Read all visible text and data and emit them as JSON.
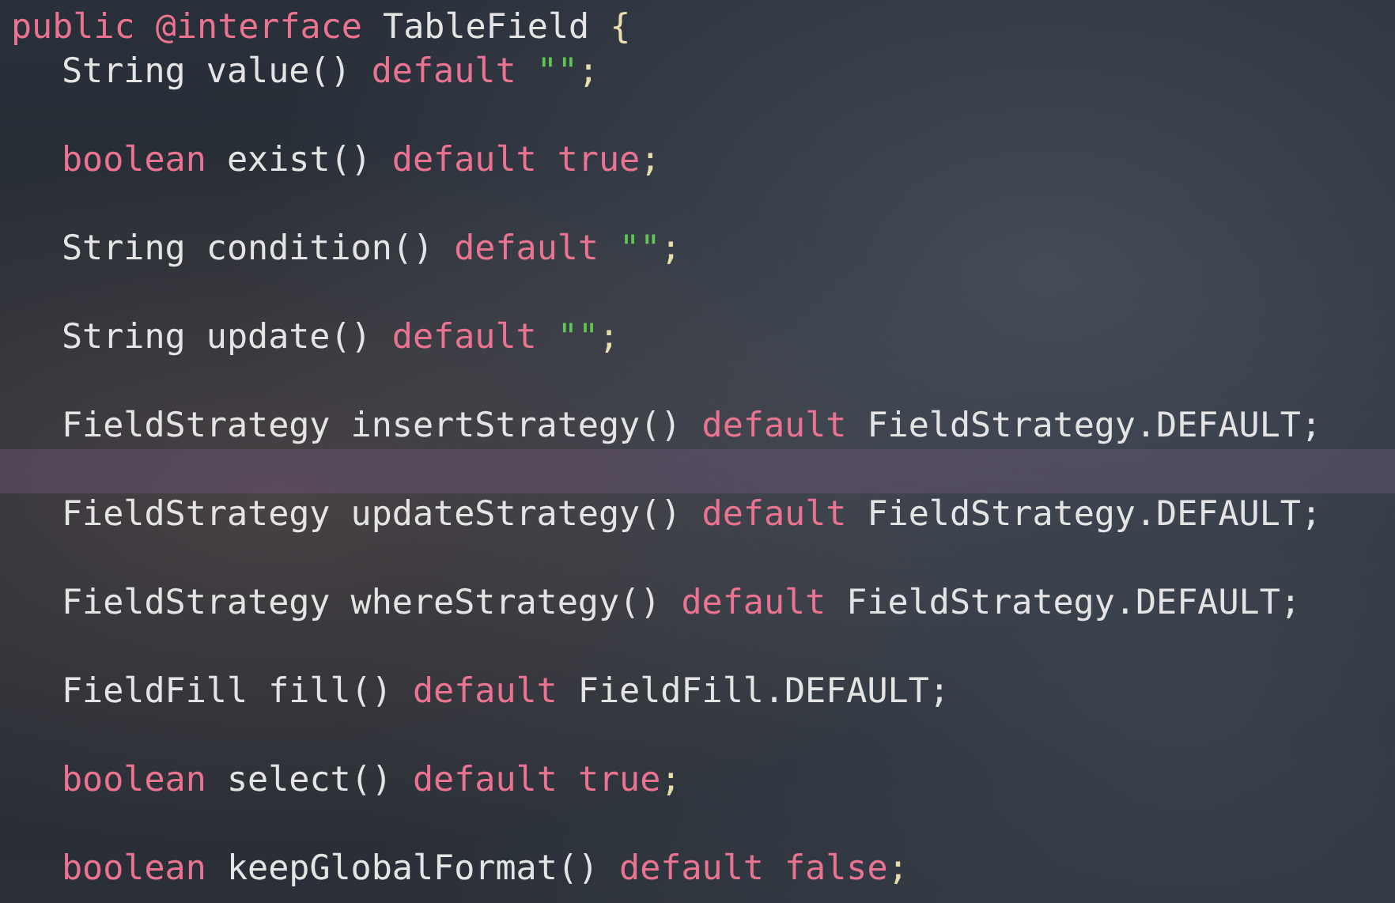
{
  "code": [
    {
      "kind": "code",
      "tokens": [
        {
          "kind": "keyword",
          "text": "public @interface"
        },
        {
          "kind": "plain",
          "text": " TableField "
        },
        {
          "kind": "punct",
          "text": "{"
        }
      ],
      "children": [
        {
          "kind": "code",
          "tokens": [
            {
              "kind": "plain",
              "text": "String value() "
            },
            {
              "kind": "keyword",
              "text": "default"
            },
            {
              "kind": "string",
              "text": " \"\""
            },
            {
              "kind": "punct",
              "text": ";"
            }
          ]
        },
        {
          "kind": "blank"
        },
        {
          "kind": "code",
          "tokens": [
            {
              "kind": "keyword",
              "text": "boolean"
            },
            {
              "kind": "plain",
              "text": " exist() "
            },
            {
              "kind": "keyword",
              "text": "default true"
            },
            {
              "kind": "punct",
              "text": ";"
            }
          ]
        },
        {
          "kind": "blank"
        },
        {
          "kind": "code",
          "tokens": [
            {
              "kind": "plain",
              "text": "String condition() "
            },
            {
              "kind": "keyword",
              "text": "default"
            },
            {
              "kind": "string",
              "text": " \"\""
            },
            {
              "kind": "punct",
              "text": ";"
            }
          ]
        },
        {
          "kind": "blank"
        },
        {
          "kind": "code",
          "tokens": [
            {
              "kind": "plain",
              "text": "String update() "
            },
            {
              "kind": "keyword",
              "text": "default"
            },
            {
              "kind": "string",
              "text": " \"\""
            },
            {
              "kind": "punct",
              "text": ";"
            }
          ]
        },
        {
          "kind": "blank"
        },
        {
          "kind": "code",
          "tokens": [
            {
              "kind": "plain",
              "text": "FieldStrategy insertStrategy() "
            },
            {
              "kind": "keyword",
              "text": "default"
            },
            {
              "kind": "plain",
              "text": " FieldStrategy.DEFAULT;"
            }
          ]
        },
        {
          "kind": "blank",
          "current": true
        },
        {
          "kind": "code",
          "tokens": [
            {
              "kind": "plain",
              "text": "FieldStrategy updateStrategy() "
            },
            {
              "kind": "keyword",
              "text": "default"
            },
            {
              "kind": "plain",
              "text": " FieldStrategy.DEFAULT;"
            }
          ]
        },
        {
          "kind": "blank"
        },
        {
          "kind": "code",
          "tokens": [
            {
              "kind": "plain",
              "text": "FieldStrategy whereStrategy() "
            },
            {
              "kind": "keyword",
              "text": "default"
            },
            {
              "kind": "plain",
              "text": " FieldStrategy.DEFAULT;"
            }
          ]
        },
        {
          "kind": "blank"
        },
        {
          "kind": "code",
          "tokens": [
            {
              "kind": "plain",
              "text": "FieldFill fill() "
            },
            {
              "kind": "keyword",
              "text": "default"
            },
            {
              "kind": "plain",
              "text": " FieldFill.DEFAULT;"
            }
          ]
        },
        {
          "kind": "blank"
        },
        {
          "kind": "code",
          "tokens": [
            {
              "kind": "keyword",
              "text": "boolean"
            },
            {
              "kind": "plain",
              "text": " select() "
            },
            {
              "kind": "keyword",
              "text": "default true"
            },
            {
              "kind": "punct",
              "text": ";"
            }
          ]
        },
        {
          "kind": "blank"
        },
        {
          "kind": "code",
          "tokens": [
            {
              "kind": "keyword",
              "text": "boolean"
            },
            {
              "kind": "plain",
              "text": " keepGlobalFormat() "
            },
            {
              "kind": "keyword",
              "text": "default false"
            },
            {
              "kind": "punct",
              "text": ";"
            }
          ]
        }
      ]
    }
  ]
}
